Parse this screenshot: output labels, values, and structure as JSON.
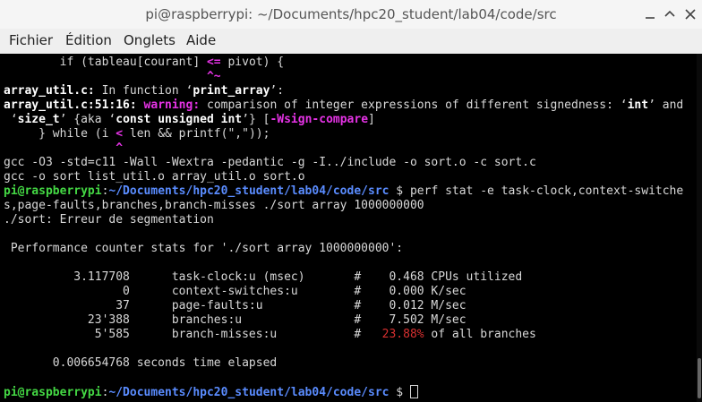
{
  "window": {
    "title": "pi@raspberrypi: ~/Documents/hpc20_student/lab04/code/src"
  },
  "menu": {
    "file": "Fichier",
    "edit": "Édition",
    "tabs": "Onglets",
    "help": "Aide"
  },
  "terminal": {
    "l0": {
      "a": "        if (tableau[courant] ",
      "b": "<=",
      "c": " pivot) {"
    },
    "l1": {
      "pad": "                             ",
      "caret": "^~"
    },
    "l2": {
      "a": "array_util.c:",
      "b": " In function ‘",
      "c": "print_array",
      "d": "’:"
    },
    "l3": {
      "a": "array_util.c:51:16: ",
      "b": "warning: ",
      "c": "comparison of integer expressions of different signedness: ‘",
      "d": "int",
      "e": "’ and"
    },
    "l4": {
      "a": " ‘",
      "b": "size_t",
      "c": "’ {aka ‘",
      "d": "const unsigned int",
      "e": "’} [",
      "f": "-Wsign-compare",
      "g": "]"
    },
    "l5": {
      "a": "     } while (i ",
      "b": "<",
      "c": " len && printf(\",\"));"
    },
    "l6": {
      "pad": "                ",
      "caret": "^"
    },
    "l7": "gcc -O3 -std=c11 -Wall -Wextra -pedantic -g -I../include -o sort.o -c sort.c",
    "l8": "gcc -o sort list_util.o array_util.o sort.o",
    "l9": {
      "user": "pi@raspberrypi",
      "colon": ":",
      "path": "~/Documents/hpc20_student/lab04/code/src",
      "dollar": " $",
      "cmd": " perf stat -e task-clock,context-switche"
    },
    "l10": "s,page-faults,branches,branch-misses ./sort array 1000000000",
    "l11": "./sort: Erreur de segmentation",
    "l12": " Performance counter stats for './sort array 1000000000':",
    "stats": [
      {
        "text": "          3.117708      task-clock:u (msec)       #    0.468 CPUs utilized"
      },
      {
        "text": "                 0      context-switches:u        #    0.000 K/sec"
      },
      {
        "text": "                37      page-faults:u             #    0.012 M/sec"
      },
      {
        "text": "            23'388      branches:u                #    7.502 M/sec"
      },
      {
        "a": "             5'585      branch-misses:u           #   ",
        "pct": "23.88%",
        "b": " of all branches"
      }
    ],
    "elapsed": "       0.006654768 seconds time elapsed",
    "prompt": {
      "user": "pi@raspberrypi",
      "colon": ":",
      "path": "~/Documents/hpc20_student/lab04/code/src",
      "dollar": " $ "
    }
  }
}
